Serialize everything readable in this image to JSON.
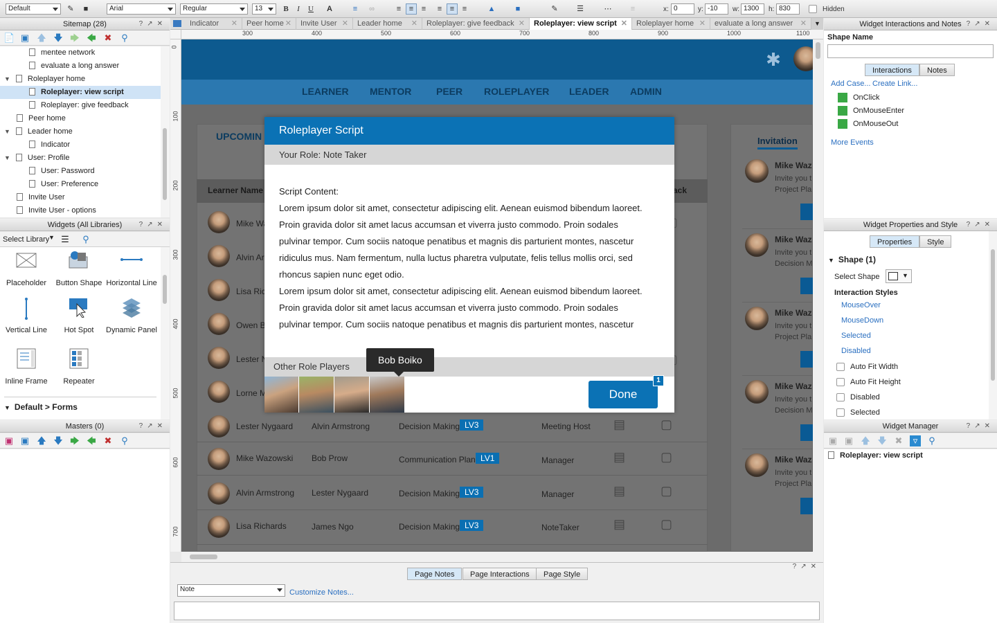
{
  "toolbar": {
    "style": "Default",
    "font": "Arial",
    "weight": "Regular",
    "size": "13",
    "x_label": "x:",
    "x_value": "0",
    "y_label": "y:",
    "y_value": "-10",
    "w_label": "w:",
    "w_value": "1300",
    "h_label": "h:",
    "h_value": "830",
    "hidden_label": "Hidden"
  },
  "sitemap": {
    "title": "Sitemap (28)",
    "items": [
      {
        "label": "mentee network"
      },
      {
        "label": "evaluate a long answer"
      },
      {
        "label": "Roleplayer home"
      },
      {
        "label": "Roleplayer: view script"
      },
      {
        "label": "Roleplayer: give feedback"
      },
      {
        "label": "Peer home"
      },
      {
        "label": "Leader home"
      },
      {
        "label": "Indicator"
      },
      {
        "label": "User: Profile"
      },
      {
        "label": "User: Password"
      },
      {
        "label": "User: Preference"
      },
      {
        "label": "Invite User"
      },
      {
        "label": "Invite User - options"
      }
    ]
  },
  "widgets": {
    "title": "Widgets (All Libraries)",
    "select_library": "Select Library",
    "items": [
      {
        "label": "Placeholder"
      },
      {
        "label": "Button Shape"
      },
      {
        "label": "Horizontal Line"
      },
      {
        "label": "Vertical Line"
      },
      {
        "label": "Hot Spot"
      },
      {
        "label": "Dynamic Panel"
      },
      {
        "label": "Inline Frame"
      },
      {
        "label": "Repeater"
      }
    ],
    "section": "Default > Forms"
  },
  "masters": {
    "title": "Masters (0)"
  },
  "tabs": [
    {
      "label": "Indicator"
    },
    {
      "label": "Peer home"
    },
    {
      "label": "Invite User"
    },
    {
      "label": "Leader home"
    },
    {
      "label": "Roleplayer: give feedback"
    },
    {
      "label": "Roleplayer: view script"
    },
    {
      "label": "Roleplayer home"
    },
    {
      "label": "evaluate a long answer"
    }
  ],
  "ruler": {
    "top": [
      "300",
      "400",
      "500",
      "600",
      "700",
      "800",
      "900",
      "1000",
      "1100"
    ],
    "left": [
      "0",
      "100",
      "200",
      "300",
      "400",
      "500",
      "600",
      "700"
    ]
  },
  "page": {
    "nav": [
      "LEARNER",
      "MENTOR",
      "PEER",
      "ROLEPLAYER",
      "LEADER",
      "ADMIN"
    ],
    "upcoming": "UPCOMIN",
    "learner_name_col": "Learner Name",
    "back_col": "ack",
    "bg_names": [
      "Mike Wa",
      "Alvin Ar",
      "Lisa Rich",
      "Owen B",
      "Lester N",
      "Lorne M"
    ],
    "rows": [
      {
        "learner": "Lester Nygaard",
        "peer": "Alvin Armstrong",
        "topic": "Decision Making",
        "level": "LV3",
        "role": "Meeting Host"
      },
      {
        "learner": "Mike Wazowski",
        "peer": "Bob Prow",
        "topic": "Communication Plan",
        "level": "LV1",
        "role": "Manager"
      },
      {
        "learner": "Alvin Armstrong",
        "peer": "Lester Nygaard",
        "topic": "Decision Making",
        "level": "LV3",
        "role": "Manager"
      },
      {
        "learner": "Lisa Richards",
        "peer": "James Ngo",
        "topic": "Decision Making",
        "level": "LV3",
        "role": "NoteTaker"
      }
    ],
    "invitation": {
      "title": "Invitation",
      "cards": [
        {
          "name": "Mike Waz",
          "line1": "Invite you t",
          "line2": "Project Pla"
        },
        {
          "name": "Mike Waz",
          "line1": "Invite you t",
          "line2": "Decision M"
        },
        {
          "name": "Mike Waz",
          "line1": "Invite you t",
          "line2": "Project Pla"
        },
        {
          "name": "Mike Waz",
          "line1": "Invite you t",
          "line2": "Decision M"
        },
        {
          "name": "Mike Waz",
          "line1": "Invite you t",
          "line2": "Project Pla"
        }
      ]
    }
  },
  "modal": {
    "title": "Roleplayer Script",
    "role": "Your Role: Note Taker",
    "content_label": "Script Content:",
    "lines": [
      "Lorem ipsum dolor sit amet, consectetur adipiscing elit. Aenean euismod bibendum laoreet.",
      "Proin gravida dolor sit amet lacus accumsan et viverra justo commodo. Proin sodales",
      "pulvinar tempor. Cum sociis natoque penatibus et magnis dis parturient montes, nascetur",
      "ridiculus mus. Nam fermentum, nulla luctus pharetra vulputate, felis tellus mollis orci, sed",
      "rhoncus sapien nunc eget odio.",
      "Lorem ipsum dolor sit amet, consectetur adipiscing elit. Aenean euismod bibendum laoreet.",
      "Proin gravida dolor sit amet lacus accumsan et viverra justo commodo. Proin sodales",
      "pulvinar tempor. Cum sociis natoque penatibus et magnis dis parturient montes, nascetur"
    ],
    "other_players": "Other Role Players",
    "tooltip": "Bob Boiko",
    "done": "Done",
    "badge": "1"
  },
  "right": {
    "interactions_title": "Widget Interactions and Notes",
    "shape_name_label": "Shape Name",
    "tab_interactions": "Interactions",
    "tab_notes": "Notes",
    "add_case": "Add Case...",
    "create_link": "Create Link...",
    "events": [
      "OnClick",
      "OnMouseEnter",
      "OnMouseOut"
    ],
    "more_events": "More Events",
    "props_title": "Widget Properties and Style",
    "tab_properties": "Properties",
    "tab_style": "Style",
    "shape_section": "Shape (1)",
    "select_shape": "Select Shape",
    "interaction_styles": "Interaction Styles",
    "styles": [
      "MouseOver",
      "MouseDown",
      "Selected",
      "Disabled"
    ],
    "checks": [
      "Auto Fit Width",
      "Auto Fit Height",
      "Disabled",
      "Selected"
    ],
    "manager_title": "Widget Manager",
    "manager_item": "Roleplayer: view script"
  },
  "notes": {
    "tabs": [
      "Page Notes",
      "Page Interactions",
      "Page Style"
    ],
    "select": "Note",
    "customize": "Customize Notes..."
  },
  "colors": {
    "accent": "#0b72b5",
    "header": "#0d5a8f",
    "nav": "#2b78b0"
  }
}
